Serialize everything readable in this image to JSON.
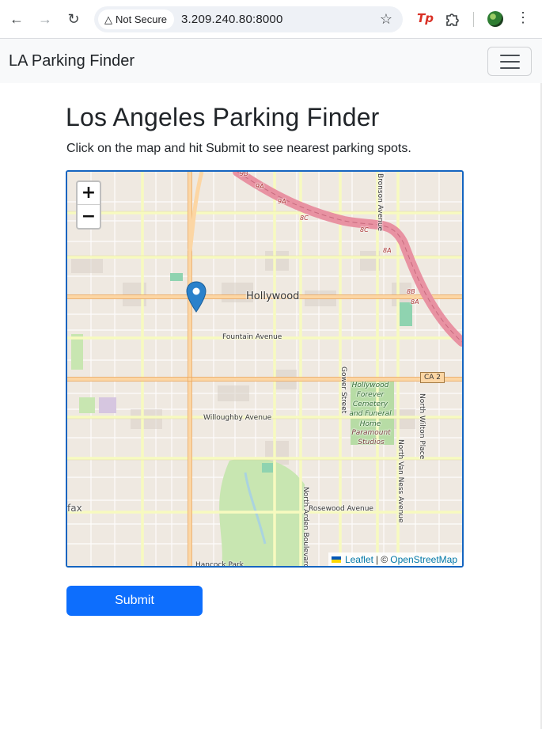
{
  "browser": {
    "security_label": "Not Secure",
    "url": "3.209.240.80:8000",
    "extension_label": "Tp"
  },
  "navbar": {
    "brand": "LA Parking Finder"
  },
  "main": {
    "title": "Los Angeles Parking Finder",
    "instructions": "Click on the map and hit Submit to see nearest parking spots.",
    "submit_label": "Submit"
  },
  "map": {
    "zoom_in": "+",
    "zoom_out": "−",
    "attribution": {
      "leaflet": "Leaflet",
      "separator": "| ©",
      "osm": "OpenStreetMap"
    },
    "labels": {
      "hollywood": "Hollywood",
      "fountain": "Fountain Avenue",
      "willoughby": "Willoughby Avenue",
      "rosewood": "Rosewood Avenue",
      "gower": "Gower Street",
      "bronson": "Bronson Avenue",
      "north_wilton": "North Wilton Place",
      "north_van_ness": "North Van Ness Avenue",
      "north_arden": "North Arden Boulevard",
      "cemetery": "Hollywood Forever Cemetery and Funeral Home",
      "studios": "Paramount Studios",
      "ca2": "CA 2",
      "fax": "fax",
      "hancock": "Hancock Park",
      "exit_9a": "9A",
      "exit_8c_1": "8C",
      "exit_8c_2": "8C",
      "exit_8a": "8A",
      "exit_8b": "8B",
      "exit_8a_2": "8A",
      "exit_9b": "9B"
    },
    "colors": {
      "freeway": "#e892a2",
      "major_road": "#fcd6a4",
      "secondary_road": "#f7fabf",
      "park": "#c8e6b1",
      "marker": "#2a81cb"
    }
  }
}
